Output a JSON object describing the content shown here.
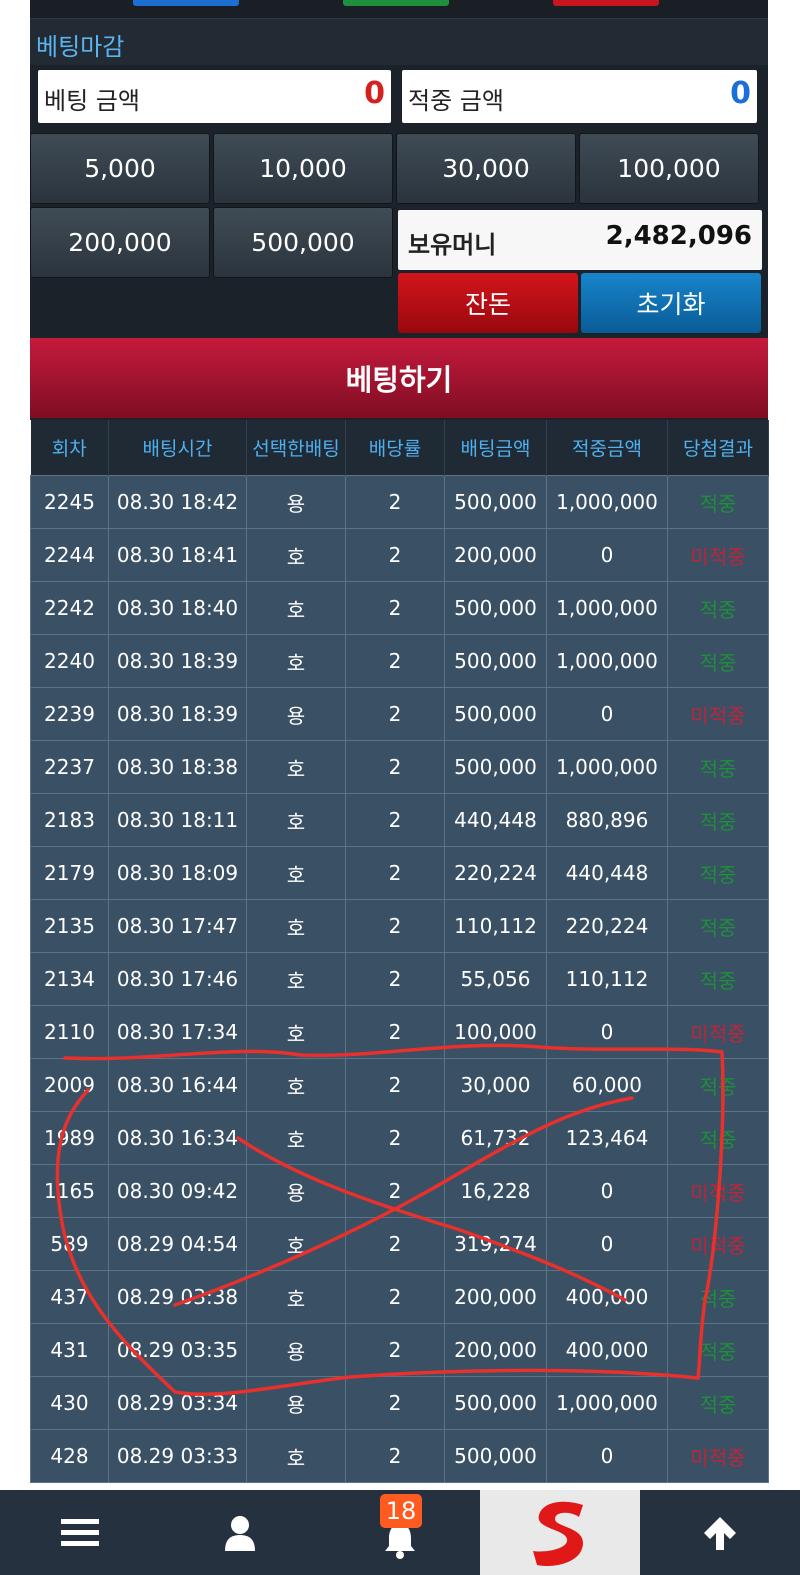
{
  "betting": {
    "closed_label": "베팅마감",
    "bet_amount_label": "베팅 금액",
    "bet_amount_value": "0",
    "win_amount_label": "적중 금액",
    "win_amount_value": "0",
    "chips": [
      "5,000",
      "10,000",
      "30,000",
      "100,000",
      "200,000",
      "500,000"
    ],
    "balance_label": "보유머니",
    "balance_value": "2,482,096",
    "change_label": "잔돈",
    "reset_label": "초기화",
    "bet_button_label": "베팅하기"
  },
  "table": {
    "headers": [
      "회차",
      "배팅시간",
      "선택한배팅",
      "배당률",
      "배팅금액",
      "적중금액",
      "당첨결과"
    ],
    "rows": [
      [
        "2245",
        "08.30 18:42",
        "용",
        "2",
        "500,000",
        "1,000,000",
        "적중"
      ],
      [
        "2244",
        "08.30 18:41",
        "호",
        "2",
        "200,000",
        "0",
        "미적중"
      ],
      [
        "2242",
        "08.30 18:40",
        "호",
        "2",
        "500,000",
        "1,000,000",
        "적중"
      ],
      [
        "2240",
        "08.30 18:39",
        "호",
        "2",
        "500,000",
        "1,000,000",
        "적중"
      ],
      [
        "2239",
        "08.30 18:39",
        "용",
        "2",
        "500,000",
        "0",
        "미적중"
      ],
      [
        "2237",
        "08.30 18:38",
        "호",
        "2",
        "500,000",
        "1,000,000",
        "적중"
      ],
      [
        "2183",
        "08.30 18:11",
        "호",
        "2",
        "440,448",
        "880,896",
        "적중"
      ],
      [
        "2179",
        "08.30 18:09",
        "호",
        "2",
        "220,224",
        "440,448",
        "적중"
      ],
      [
        "2135",
        "08.30 17:47",
        "호",
        "2",
        "110,112",
        "220,224",
        "적중"
      ],
      [
        "2134",
        "08.30 17:46",
        "호",
        "2",
        "55,056",
        "110,112",
        "적중"
      ],
      [
        "2110",
        "08.30 17:34",
        "호",
        "2",
        "100,000",
        "0",
        "미적중"
      ],
      [
        "2009",
        "08.30 16:44",
        "호",
        "2",
        "30,000",
        "60,000",
        "적중"
      ],
      [
        "1989",
        "08.30 16:34",
        "호",
        "2",
        "61,732",
        "123,464",
        "적중"
      ],
      [
        "1165",
        "08.30 09:42",
        "용",
        "2",
        "16,228",
        "0",
        "미적중"
      ],
      [
        "589",
        "08.29 04:54",
        "호",
        "2",
        "319,274",
        "0",
        "미적중"
      ],
      [
        "437",
        "08.29 03:38",
        "호",
        "2",
        "200,000",
        "400,000",
        "적중"
      ],
      [
        "431",
        "08.29 03:35",
        "용",
        "2",
        "200,000",
        "400,000",
        "적중"
      ],
      [
        "430",
        "08.29 03:34",
        "용",
        "2",
        "500,000",
        "1,000,000",
        "적중"
      ],
      [
        "428",
        "08.29 03:33",
        "호",
        "2",
        "500,000",
        "0",
        "미적중"
      ]
    ]
  },
  "nav": {
    "notification_count": "18",
    "icons": [
      "menu-icon",
      "user-icon",
      "bell-icon",
      "logo",
      "arrow-up-icon"
    ]
  },
  "colors": {
    "accent_blue": "#5bb4f0",
    "bet_red": "#c51a3c",
    "win_green": "#1e8f3a",
    "lose_red": "#c0243a",
    "annotation": "#e8302c"
  }
}
